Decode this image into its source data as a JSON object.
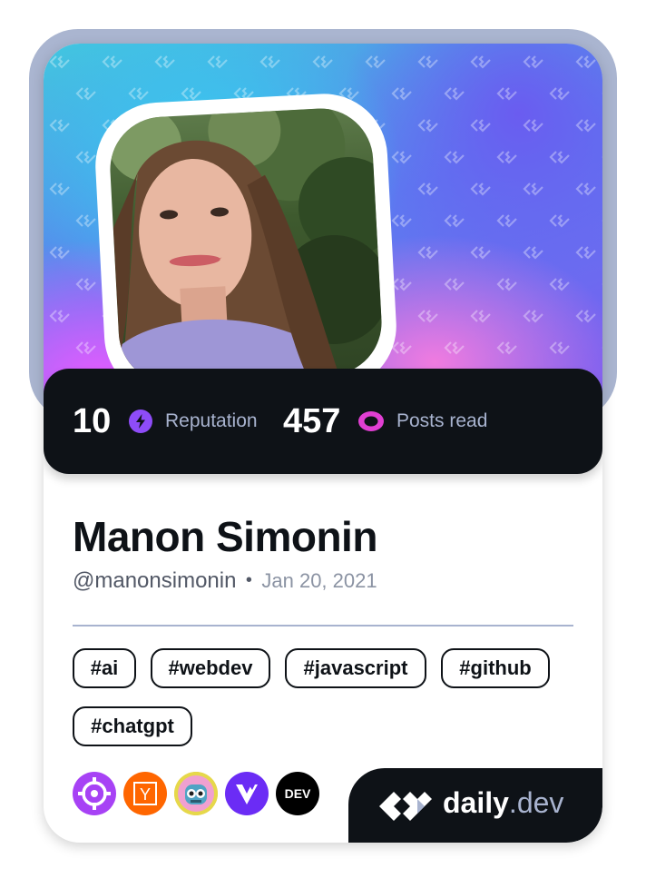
{
  "profile": {
    "name": "Manon Simonin",
    "handle": "@manonsimonin",
    "separator": "•",
    "joined": "Jan 20, 2021"
  },
  "stats": {
    "reputation_value": "10",
    "reputation_label": "Reputation",
    "posts_value": "457",
    "posts_label": "Posts read"
  },
  "tags": [
    "#ai",
    "#webdev",
    "#javascript",
    "#github",
    "#chatgpt"
  ],
  "sources": [
    {
      "name": "crosshair-source-icon",
      "color": "#a742f5"
    },
    {
      "name": "hacker-news-icon",
      "color": "#ff6600",
      "glyph": "Y"
    },
    {
      "name": "robot-source-icon",
      "color": "#e0c838"
    },
    {
      "name": "vercel-v-icon",
      "color": "#6b2cf5"
    },
    {
      "name": "dev-to-icon",
      "color": "#000000",
      "glyph": "DEV"
    }
  ],
  "brand": {
    "name_bold": "daily",
    "name_light": ".dev"
  },
  "colors": {
    "background_dark": "#0e1217",
    "reputation_accent": "#8e4cf8",
    "posts_accent": "#e13fd3",
    "secondary_text": "#a8b3cf"
  }
}
